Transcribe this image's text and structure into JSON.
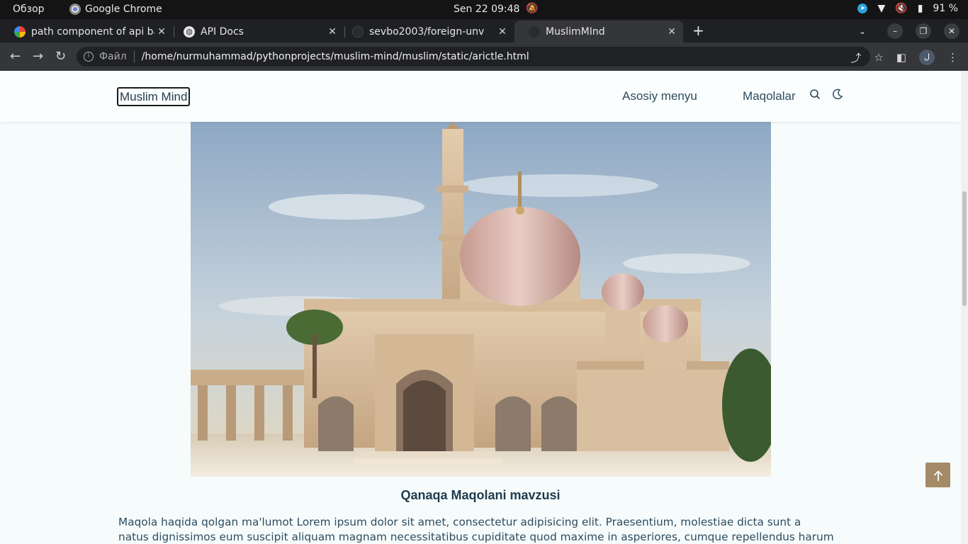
{
  "system": {
    "overview": "Обзор",
    "app_name": "Google Chrome",
    "clock": "Sen 22  09:48",
    "battery": "91 %"
  },
  "tabs": [
    {
      "title": "path component of api ba",
      "favicon": "google-icon",
      "active": false
    },
    {
      "title": "API Docs",
      "favicon": "globe-icon",
      "active": false
    },
    {
      "title": "sevbo2003/foreign-unv",
      "favicon": "github-icon",
      "active": false
    },
    {
      "title": "MuslimMInd",
      "favicon": "site-icon",
      "active": true
    }
  ],
  "address_bar": {
    "scheme_label": "Файл",
    "url": "/home/nurmuhammad/pythonprojects/muslim-mind/muslim/static/arictle.html",
    "profile_initial": "ل"
  },
  "site": {
    "logo": "Muslim Mind",
    "nav": [
      "Asosiy menyu",
      "Maqolalar"
    ]
  },
  "article": {
    "title": "Qanaqa Maqolani mavzusi",
    "body": "Maqola haqida qolgan ma'lumot Lorem ipsum dolor sit amet, consectetur adipisicing elit. Praesentium, molestiae dicta sunt a natus dignissimos eum suscipit aliquam magnam necessitatibus cupiditate quod maxime in asperiores, cumque repellendus harum tempore"
  },
  "colors": {
    "accent": "#a48a66",
    "text": "#2d4c5f",
    "background": "#f6fcfc"
  }
}
